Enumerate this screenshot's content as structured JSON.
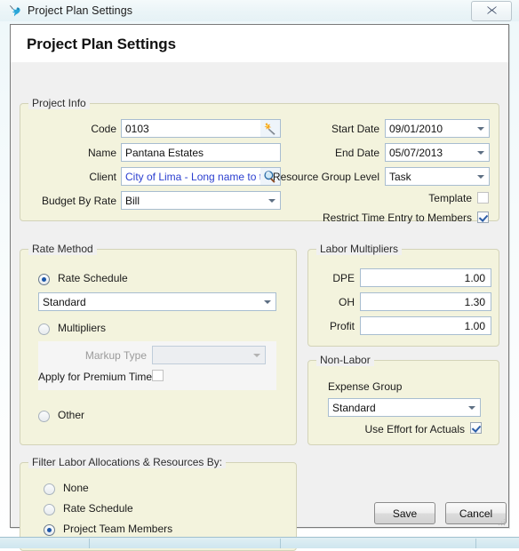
{
  "window": {
    "title": "Project Plan Settings",
    "icon": "bird-icon",
    "close_label": "✖"
  },
  "dialog": {
    "heading": "Project Plan Settings"
  },
  "project_info": {
    "legend": "Project Info",
    "code_label": "Code",
    "code_value": "0103",
    "code_icon": "magic-wand-icon",
    "name_label": "Name",
    "name_value": "Pantana Estates",
    "client_label": "Client",
    "client_value": "City of Lima - Long name to t",
    "client_icon": "search-icon",
    "budget_by_rate_label": "Budget By Rate",
    "budget_by_rate_value": "Bill",
    "start_date_label": "Start Date",
    "start_date_value": "09/01/2010",
    "end_date_label": "End Date",
    "end_date_value": "05/07/2013",
    "resource_group_level_label": "Resource Group Level",
    "resource_group_level_value": "Task",
    "template_label": "Template",
    "template_checked": false,
    "restrict_label": "Restrict Time Entry to Members",
    "restrict_checked": true
  },
  "rate_method": {
    "legend": "Rate Method",
    "rate_schedule_label": "Rate Schedule",
    "rate_schedule_selected": true,
    "rate_schedule_value": "Standard",
    "multipliers_label": "Multipliers",
    "multipliers_selected": false,
    "markup_type_label": "Markup Type",
    "markup_type_value": "",
    "apply_premium_label": "Apply for Premium Time",
    "apply_premium_checked": false,
    "other_label": "Other",
    "other_selected": false
  },
  "labor_multipliers": {
    "legend": "Labor Multipliers",
    "dpe_label": "DPE",
    "dpe_value": "1.00",
    "oh_label": "OH",
    "oh_value": "1.30",
    "profit_label": "Profit",
    "profit_value": "1.00"
  },
  "non_labor": {
    "legend": "Non-Labor",
    "expense_group_label": "Expense Group",
    "expense_group_value": "Standard",
    "use_effort_label": "Use Effort for Actuals",
    "use_effort_checked": true
  },
  "filter_section": {
    "legend": "Filter Labor Allocations & Resources By:",
    "none_label": "None",
    "none_selected": false,
    "rate_schedule_label": "Rate Schedule",
    "rate_schedule_selected": false,
    "project_team_label": "Project Team Members",
    "project_team_selected": true
  },
  "actions": {
    "save_label": "Save",
    "cancel_label": "Cancel"
  },
  "colors": {
    "groupbox_bg": "#f3f3dd",
    "groupbox_border": "#d3d3b8",
    "dialog_bg": "#f0f0f0",
    "link_text": "#2b3fd0",
    "field_border": "#a8bdd0"
  }
}
